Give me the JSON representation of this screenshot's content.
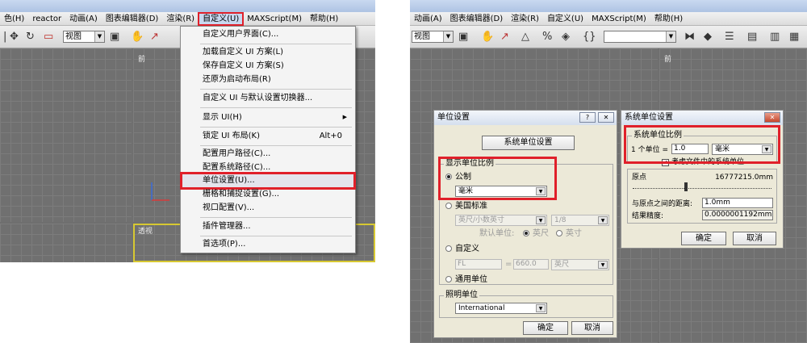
{
  "left": {
    "menu": [
      "色(H)",
      "reactor",
      "动画(A)",
      "图表编辑器(D)",
      "渲染(R)",
      "自定义(U)",
      "MAXScript(M)",
      "帮助(H)"
    ],
    "view_select": "视图",
    "vp_front": "前",
    "vp_persp": "透视",
    "dropdown": [
      {
        "label": "自定义用户界面(C)..."
      },
      {
        "label": "加载自定义 UI 方案(L)"
      },
      {
        "label": "保存自定义 UI 方案(S)"
      },
      {
        "label": "还原为启动布局(R)"
      },
      {
        "label": "自定义 UI 与默认设置切换器..."
      },
      {
        "label": "显示 UI(H)",
        "submenu": "▶"
      },
      {
        "label": "锁定 UI 布局(K)",
        "shortcut": "Alt+0"
      },
      {
        "label": "配置用户路径(C)..."
      },
      {
        "label": "配置系统路径(C)..."
      },
      {
        "label": "单位设置(U)..."
      },
      {
        "label": "栅格和捕捉设置(G)..."
      },
      {
        "label": "视口配置(V)..."
      },
      {
        "label": "插件管理器..."
      },
      {
        "label": "首选项(P)..."
      }
    ]
  },
  "right": {
    "menu": [
      "动画(A)",
      "图表编辑器(D)",
      "渲染(R)",
      "自定义(U)",
      "MAXScript(M)",
      "帮助(H)"
    ],
    "view_select": "视图",
    "vp_front": "前",
    "units_dialog": {
      "title": "单位设置",
      "help_btn": "?",
      "close_btn": "✕",
      "system_btn": "系统单位设置",
      "display_group": "显示单位比例",
      "metric": "公制",
      "metric_value": "毫米",
      "us_standard": "美国标准",
      "us_value": "英尺/小数英寸",
      "us_fraction": "1/8",
      "default_units_label": "默认单位:",
      "feet": "英尺",
      "inches": "英寸",
      "custom": "自定义",
      "custom_name": "FL",
      "custom_eq": "=",
      "custom_value": "660.0",
      "custom_unit": "英尺",
      "generic": "通用单位",
      "lighting_group": "照明单位",
      "lighting_value": "International",
      "ok": "确定",
      "cancel": "取消"
    },
    "system_dialog": {
      "title": "系统单位设置",
      "close_btn": "✕",
      "scale_group": "系统单位比例",
      "unit_prefix": "1 个单位 =",
      "unit_value": "1.0",
      "unit_type": "毫米",
      "consider_files": "考虑文件中的系统单位",
      "check_mark": "✓",
      "origin_label": "原点",
      "origin_value": "16777215.0mm",
      "distance_label": "与原点之间的距离:",
      "distance_value": "1.0mm",
      "precision_label": "结果精度:",
      "precision_value": "0.0000001192mm",
      "ok": "确定",
      "cancel": "取消"
    }
  }
}
